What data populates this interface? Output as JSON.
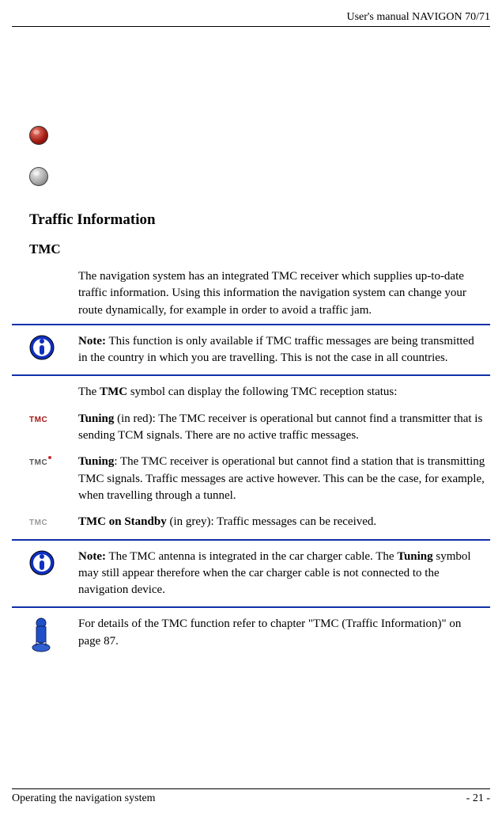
{
  "header": {
    "title": "User's manual NAVIGON 70/71"
  },
  "section_title": "Traffic Information",
  "subsection_title": "TMC",
  "intro": "The navigation system has an integrated TMC receiver which supplies up-to-date traffic information. Using this information the navigation system can change your route dynamically, for example in order to avoid a traffic jam.",
  "note1_label": "Note:",
  "note1_text": " This function is only available if TMC traffic messages are being transmitted in the country in which you are travelling. This is not the case in all countries.",
  "tmc_intro_pre": "The ",
  "tmc_intro_bold": "TMC",
  "tmc_intro_post": " symbol can display the following TMC reception status:",
  "tuning_red_label": "Tuning",
  "tuning_red_text": " (in red): The TMC receiver is operational but cannot find a transmitter that is sending TCM signals. There are no active traffic messages.",
  "tuning_label": "Tuning",
  "tuning_text": ": The TMC receiver is operational but cannot find a station that is transmitting TMC signals. Traffic messages are active however. This can be the case, for example, when travelling through a tunnel.",
  "standby_label": "TMC on Standby",
  "standby_text": " (in grey): Traffic messages can be received.",
  "note2_label": "Note:",
  "note2_text_pre": " The TMC antenna is integrated in the car charger cable. The ",
  "note2_text_bold": "Tuning",
  "note2_text_post": " symbol may still appear therefore when the car charger cable is not connected to the navigation device.",
  "details_text": "For details of the TMC function refer to chapter \"TMC (Traffic Information)\" on page 87.",
  "tmc_icon_label": "TMC",
  "footer": {
    "left": "Operating the navigation system",
    "right": "- 21 -"
  }
}
